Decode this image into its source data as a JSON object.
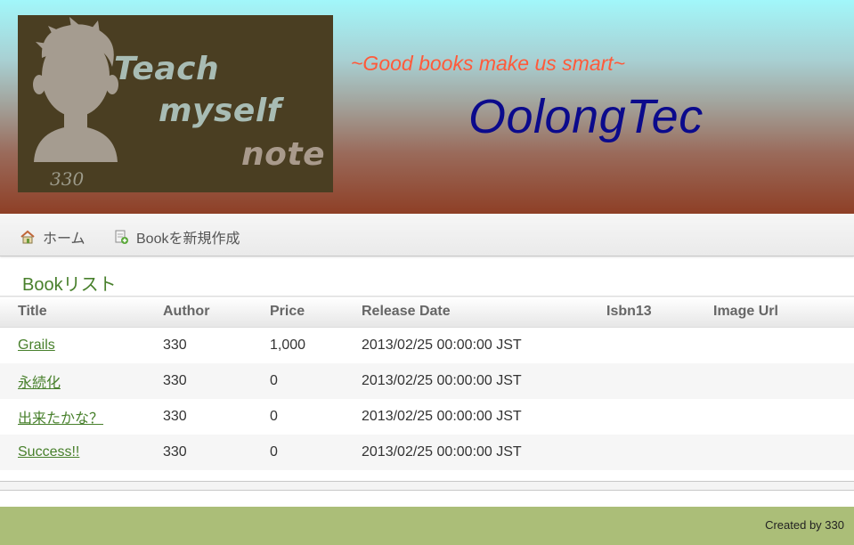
{
  "header": {
    "logo": {
      "line1": "Teach",
      "line2": "myself",
      "line3": "note",
      "signature": "330"
    },
    "tagline": "~Good books make us smart~",
    "site_title": "OolongTec"
  },
  "nav": {
    "home_label": "ホーム",
    "create_label": "Bookを新規作成",
    "home_icon": "house-icon",
    "create_icon": "new-document-icon"
  },
  "main": {
    "list_title": "Bookリスト",
    "columns": [
      "Title",
      "Author",
      "Price",
      "Release Date",
      "Isbn13",
      "Image Url"
    ],
    "rows": [
      {
        "title": "Grails",
        "author": "330",
        "price": "1,000",
        "release_date": "2013/02/25 00:00:00 JST",
        "isbn13": "",
        "image_url": ""
      },
      {
        "title": "永続化",
        "author": "330",
        "price": "0",
        "release_date": "2013/02/25 00:00:00 JST",
        "isbn13": "",
        "image_url": ""
      },
      {
        "title": "出来たかな？",
        "author": "330",
        "price": "0",
        "release_date": "2013/02/25 00:00:00 JST",
        "isbn13": "",
        "image_url": ""
      },
      {
        "title": "Success!!",
        "author": "330",
        "price": "0",
        "release_date": "2013/02/25 00:00:00 JST",
        "isbn13": "",
        "image_url": ""
      }
    ]
  },
  "footer": {
    "text": "Created by 330"
  },
  "colors": {
    "accent_green": "#48802c",
    "tagline": "#ff5a3a",
    "title_blue": "#0b0a8c",
    "footer_bg": "#abbe78"
  }
}
